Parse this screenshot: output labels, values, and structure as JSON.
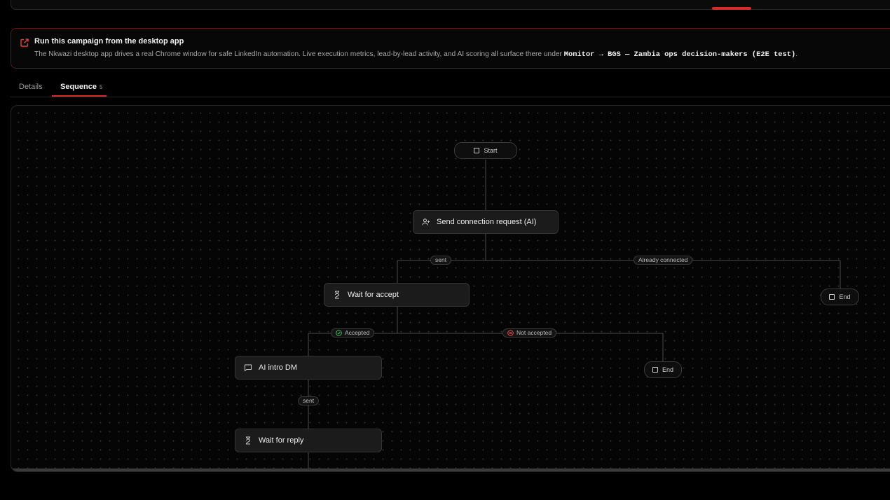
{
  "banner": {
    "title": "Run this campaign from the desktop app",
    "body_prefix": "The Nkwazi desktop app drives a real Chrome window for safe LinkedIn automation. Live execution metrics, lead-by-lead activity, and AI scoring all surface there under ",
    "body_code": "Monitor → BGS — Zambia ops decision-makers (E2E test)",
    "body_suffix": "."
  },
  "tabs": {
    "details": "Details",
    "sequence": "Sequence",
    "sequence_count": "5"
  },
  "flow": {
    "start": "Start",
    "send_request": "Send connection request (AI)",
    "wait_accept": "Wait for accept",
    "ai_intro": "AI intro DM",
    "wait_reply": "Wait for reply",
    "end_1": "End",
    "end_2": "End",
    "edge_sent_1": "sent",
    "edge_already": "Already connected",
    "edge_accepted": "Accepted",
    "edge_not_accepted": "Not accepted",
    "edge_sent_2": "sent"
  },
  "colors": {
    "accent": "#d92a2a",
    "accepted": "#3fbf5f",
    "not_accepted": "#e04848"
  }
}
